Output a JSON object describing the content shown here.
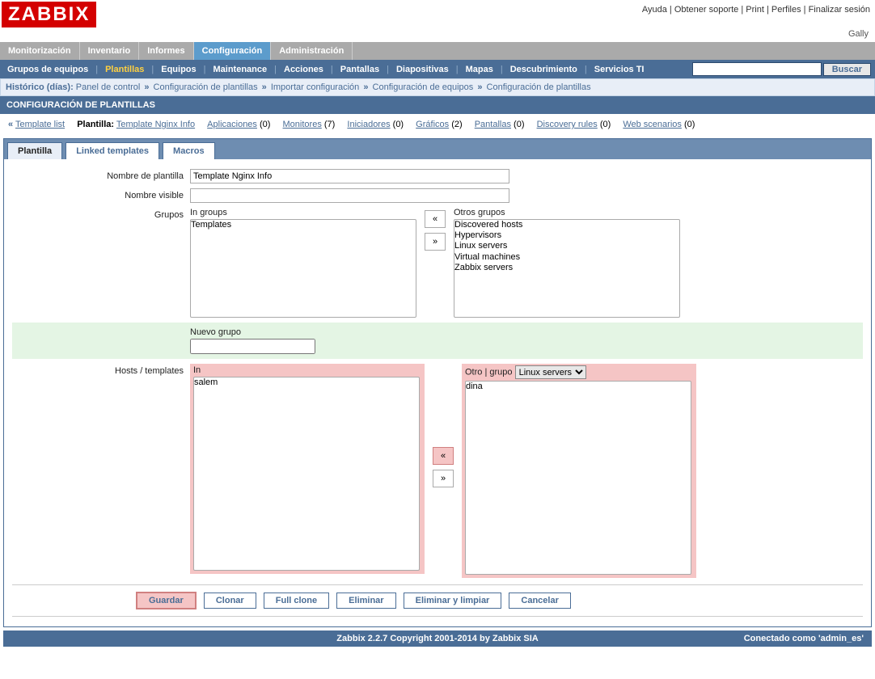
{
  "top_links": {
    "help": "Ayuda",
    "support": "Obtener soporte",
    "print": "Print",
    "profile": "Perfiles",
    "logout": "Finalizar sesión"
  },
  "user": "Gally",
  "main_nav": {
    "monitoring": "Monitorización",
    "inventory": "Inventario",
    "reports": "Informes",
    "configuration": "Configuración",
    "administration": "Administración"
  },
  "sub_nav": {
    "hostgroups": "Grupos de equipos",
    "templates": "Plantillas",
    "hosts": "Equipos",
    "maintenance": "Maintenance",
    "actions": "Acciones",
    "screens": "Pantallas",
    "slides": "Diapositivas",
    "maps": "Mapas",
    "discovery": "Descubrimiento",
    "itservices": "Servicios TI",
    "search_btn": "Buscar"
  },
  "history": {
    "label": "Histórico (días):",
    "items": [
      "Panel de control",
      "Configuración de plantillas",
      "Importar configuración",
      "Configuración de equipos",
      "Configuración de plantillas"
    ]
  },
  "page_title": "CONFIGURACIÓN DE PLANTILLAS",
  "link_bar": {
    "templ_list": "Template list",
    "templ_label": "Plantilla:",
    "templ_name_link": "Template Nginx Info",
    "apps": "Aplicaciones",
    "apps_n": "(0)",
    "items": "Monitores",
    "items_n": "(7)",
    "triggers": "Iniciadores",
    "triggers_n": "(0)",
    "graphs": "Gráficos",
    "graphs_n": "(2)",
    "screens": "Pantallas",
    "screens_n": "(0)",
    "discovery": "Discovery rules",
    "discovery_n": "(0)",
    "web": "Web scenarios",
    "web_n": "(0)"
  },
  "tabs": {
    "template": "Plantilla",
    "linked": "Linked templates",
    "macros": "Macros"
  },
  "form": {
    "name_label": "Nombre de plantilla",
    "name_value": "Template Nginx Info",
    "visible_label": "Nombre visible",
    "visible_value": "",
    "groups_label": "Grupos",
    "in_groups_label": "In groups",
    "other_groups_label": "Otros grupos",
    "in_groups": [
      "Templates"
    ],
    "other_groups": [
      "Discovered hosts",
      "Hypervisors",
      "Linux servers",
      "Virtual machines",
      "Zabbix servers"
    ],
    "new_group_label": "Nuevo grupo",
    "new_group_value": "",
    "hosts_label": "Hosts / templates",
    "in_label": "In",
    "other_label": "Otro",
    "group_word": "grupo",
    "group_select": "Linux servers",
    "in_hosts": [
      "salem"
    ],
    "other_hosts": [
      "dina"
    ],
    "arrow_left": "«",
    "arrow_right": "»"
  },
  "buttons": {
    "save": "Guardar",
    "clone": "Clonar",
    "fullclone": "Full clone",
    "delete": "Eliminar",
    "deleteclear": "Eliminar y limpiar",
    "cancel": "Cancelar"
  },
  "footer": {
    "copyright": "Zabbix 2.2.7 Copyright 2001-2014 by Zabbix SIA",
    "connected": "Conectado como 'admin_es'"
  }
}
